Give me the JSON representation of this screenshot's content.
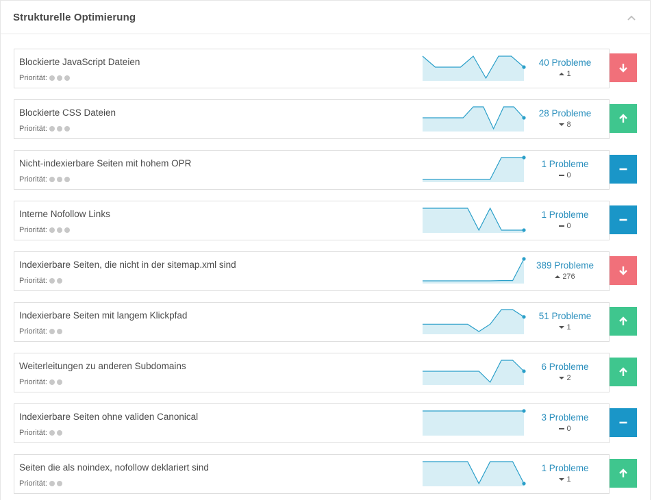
{
  "header": {
    "title": "Strukturelle Optimierung"
  },
  "colors": {
    "up": "#3fc68e",
    "down": "#f1707a",
    "neutral": "#1a96c8",
    "line": "#2a9fc9",
    "fill": "#d7eef5"
  },
  "rows": [
    {
      "title": "Blockierte JavaScript Dateien",
      "priority_label": "Priorität:",
      "priority": 3,
      "count": "40 Probleme",
      "delta": "1",
      "delta_dir": "up",
      "trend": "down",
      "spark": [
        40,
        39,
        39,
        39,
        40,
        38,
        40,
        40,
        39
      ]
    },
    {
      "title": "Blockierte CSS Dateien",
      "priority_label": "Priorität:",
      "priority": 3,
      "count": "28 Probleme",
      "delta": "8",
      "delta_dir": "down",
      "trend": "up",
      "spark": [
        30,
        30,
        30,
        30,
        30,
        31,
        31,
        29,
        31,
        31,
        30
      ]
    },
    {
      "title": "Nicht-indexierbare Seiten mit hohem OPR",
      "priority_label": "Priorität:",
      "priority": 3,
      "count": "1 Probleme",
      "delta": "0",
      "delta_dir": "flat",
      "trend": "neutral",
      "spark": [
        0,
        0,
        0,
        0,
        0,
        0,
        0,
        1,
        1,
        1
      ]
    },
    {
      "title": "Interne Nofollow Links",
      "priority_label": "Priorität:",
      "priority": 3,
      "count": "1 Probleme",
      "delta": "0",
      "delta_dir": "flat",
      "trend": "neutral",
      "spark": [
        2,
        2,
        2,
        2,
        2,
        1,
        2,
        1,
        1,
        1
      ]
    },
    {
      "title": "Indexierbare Seiten, die nicht in der sitemap.xml sind",
      "priority_label": "Priorität:",
      "priority": 2,
      "count": "389 Probleme",
      "delta": "276",
      "delta_dir": "up",
      "trend": "down",
      "spark": [
        110,
        110,
        110,
        110,
        110,
        110,
        110,
        113,
        113,
        389
      ]
    },
    {
      "title": "Indexierbare Seiten mit langem Klickpfad",
      "priority_label": "Priorität:",
      "priority": 2,
      "count": "51 Probleme",
      "delta": "1",
      "delta_dir": "down",
      "trend": "up",
      "spark": [
        51,
        51,
        51,
        51,
        51,
        50,
        51,
        53,
        53,
        52
      ]
    },
    {
      "title": "Weiterleitungen zu anderen Subdomains",
      "priority_label": "Priorität:",
      "priority": 2,
      "count": "6 Probleme",
      "delta": "2",
      "delta_dir": "down",
      "trend": "up",
      "spark": [
        7,
        7,
        7,
        7,
        7,
        7,
        6,
        8,
        8,
        7
      ]
    },
    {
      "title": "Indexierbare Seiten ohne validen Canonical",
      "priority_label": "Priorität:",
      "priority": 2,
      "count": "3 Probleme",
      "delta": "0",
      "delta_dir": "flat",
      "trend": "neutral",
      "spark": [
        3,
        3,
        3,
        3,
        3,
        3,
        3,
        3,
        3,
        3
      ]
    },
    {
      "title": "Seiten die als noindex, nofollow deklariert sind",
      "priority_label": "Priorität:",
      "priority": 2,
      "count": "1 Probleme",
      "delta": "1",
      "delta_dir": "down",
      "trend": "up",
      "spark": [
        2,
        2,
        2,
        2,
        2,
        1,
        2,
        2,
        2,
        1
      ]
    }
  ]
}
